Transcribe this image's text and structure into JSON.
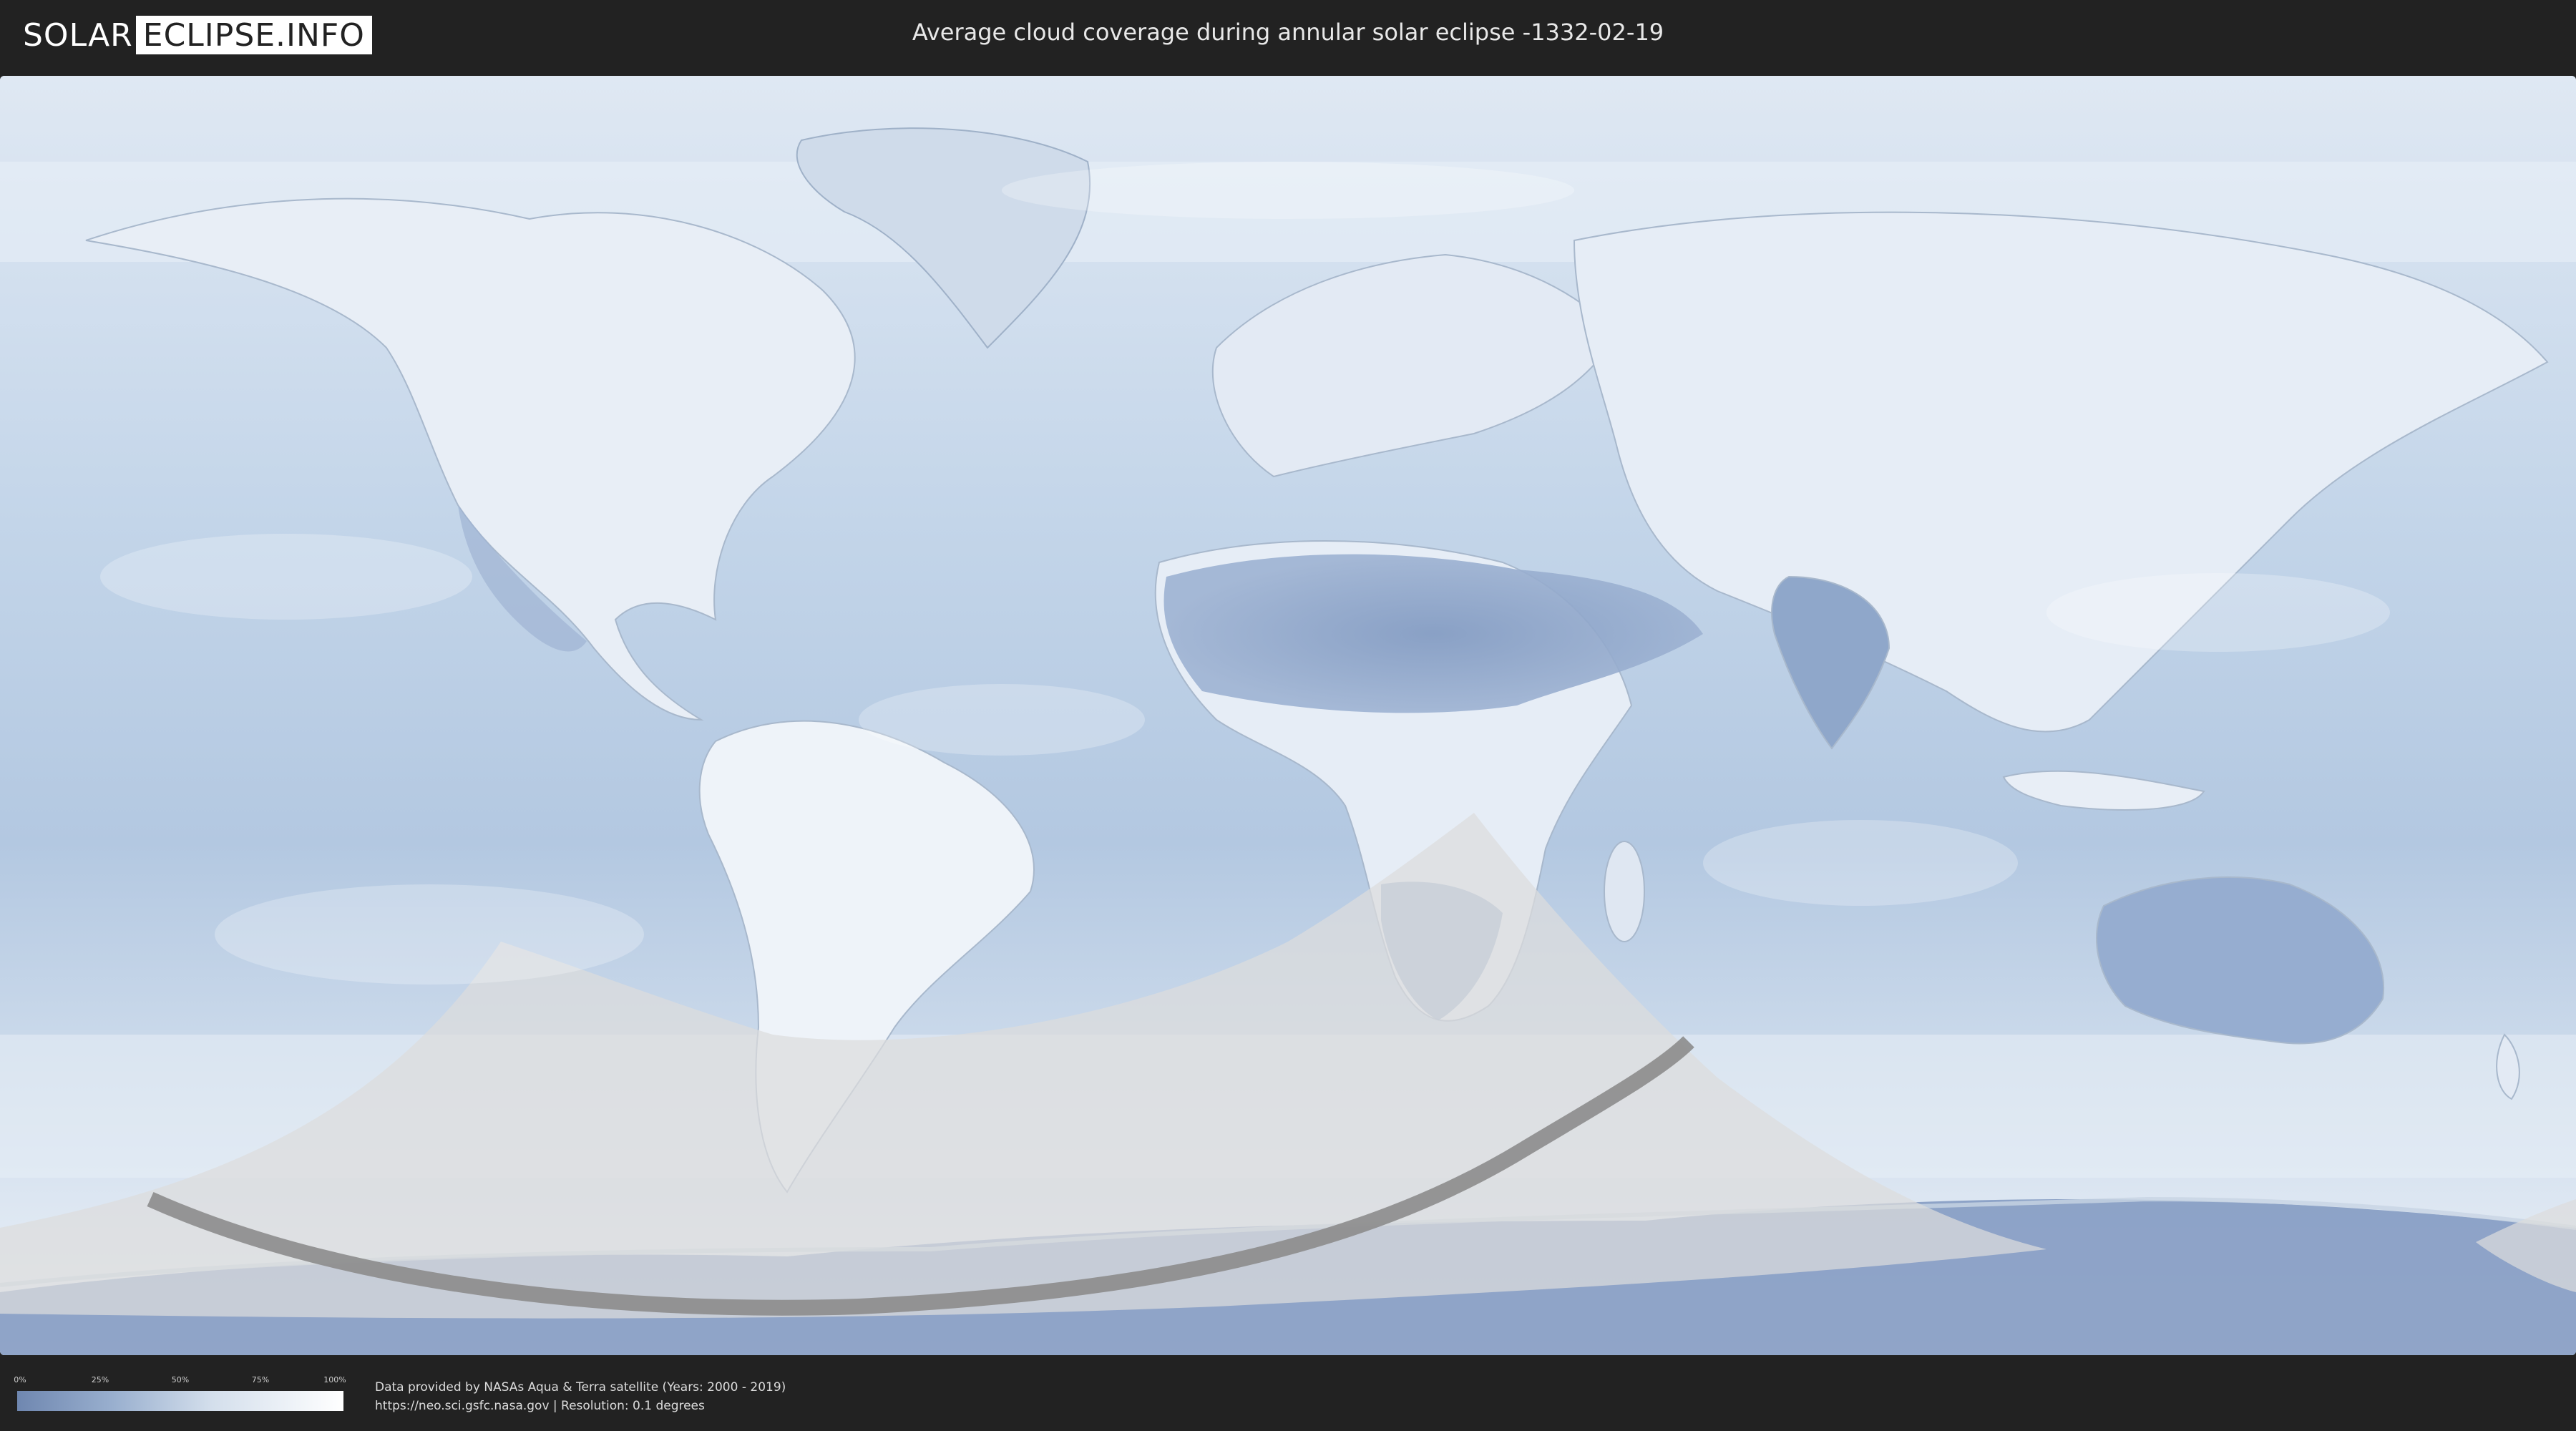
{
  "header": {
    "logo_left": "SOLAR",
    "logo_right": "ECLIPSE.INFO",
    "title": "Average cloud coverage during annular solar eclipse -1332-02-19"
  },
  "legend": {
    "ticks": [
      "0%",
      "25%",
      "50%",
      "75%",
      "100%"
    ],
    "colors": [
      "#6f87b0",
      "#9ab0cf",
      "#d4dfec",
      "#ffffff"
    ]
  },
  "credits": {
    "line1": "Data provided by NASAs Aqua & Terra satellite (Years: 2000 - 2019)",
    "line2": "https://neo.sci.gsfc.nasa.gov | Resolution: 0.1 degrees"
  },
  "map": {
    "colors": {
      "ocean": "#bcd0e6",
      "land": "#e9eff7",
      "dry_land": "#8ea5c8",
      "penumbra": "#d9d9d9",
      "central_path": "#8c8c8c"
    }
  }
}
